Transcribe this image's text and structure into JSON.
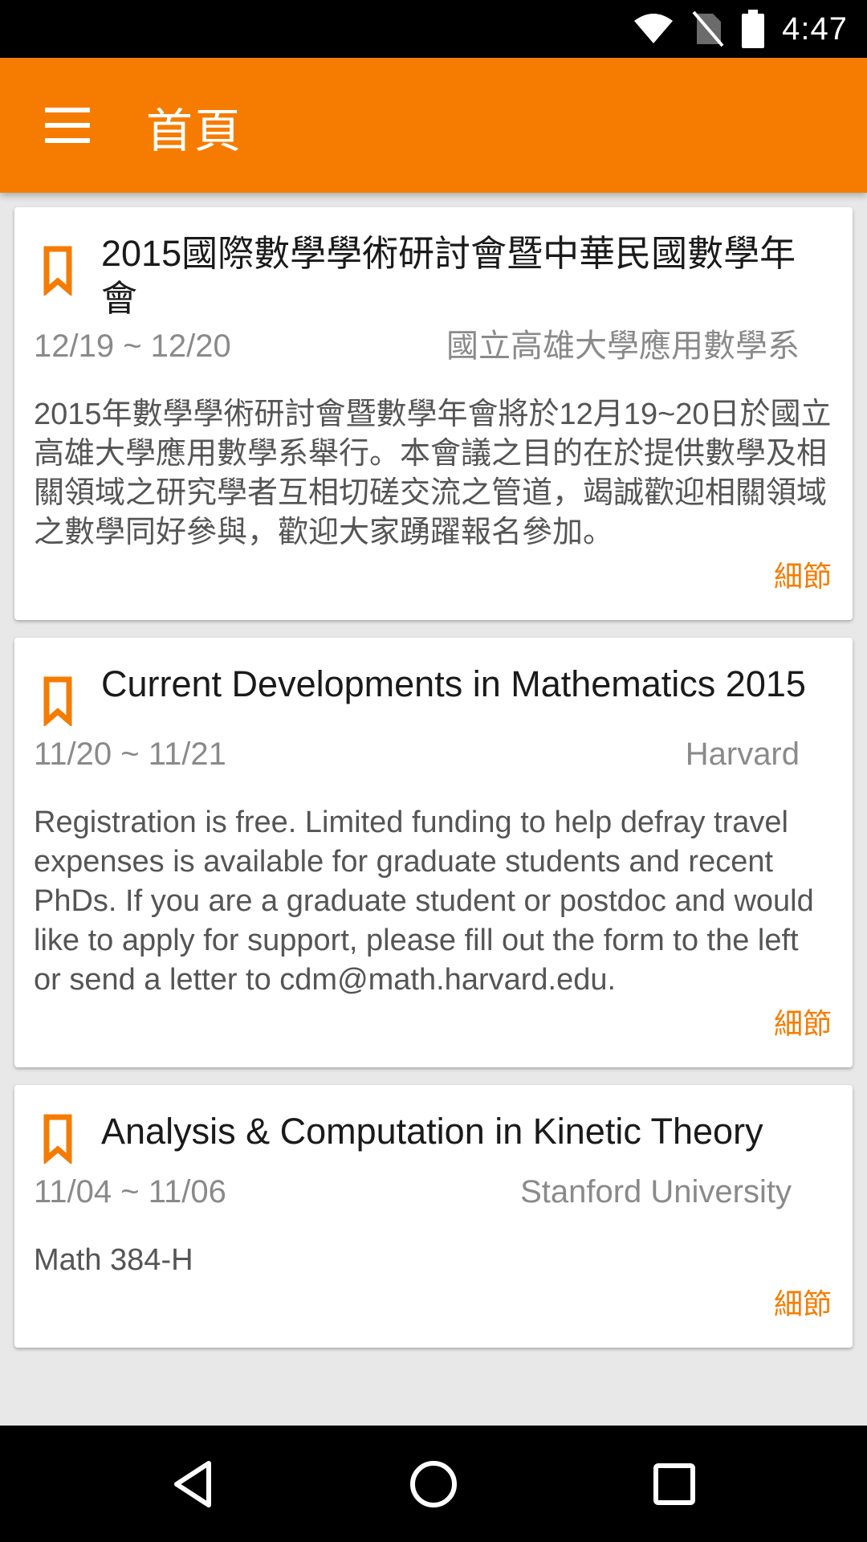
{
  "status_bar": {
    "time": "4:47",
    "icons": [
      "wifi-icon",
      "no-sim-icon",
      "battery-icon"
    ]
  },
  "app_bar": {
    "title": "首頁",
    "menu_icon": "hamburger-menu-icon",
    "color": "#f57c00"
  },
  "events": [
    {
      "title": "2015國際數學學術研討會暨中華民國數學年會",
      "dates": "12/19 ~ 12/20",
      "location": "國立高雄大學應用數學系",
      "description": "2015年數學學術研討會暨數學年會將於12月19~20日於國立高雄大學應用數學系舉行。本會議之目的在於提供數學及相關領域之研究學者互相切磋交流之管道，竭誠歡迎相關領域之數學同好參與，歡迎大家踴躍報名參加。",
      "details_label": "細節"
    },
    {
      "title": "Current Developments in Mathematics 2015",
      "dates": "11/20 ~ 11/21",
      "location": "Harvard",
      "description": "Registration is free. Limited funding to help defray travel expenses is available for graduate students and recent PhDs. If you are a graduate student or postdoc and would like to apply for support, please fill out the form to the left or send a letter to cdm@math.harvard.edu.",
      "details_label": "細節"
    },
    {
      "title": "Analysis & Computation in Kinetic Theory",
      "dates": "11/04 ~ 11/06",
      "location": "Stanford University",
      "description": "Math 384-H",
      "details_label": "細節"
    }
  ],
  "nav_bar": {
    "buttons": [
      "back-icon",
      "home-icon",
      "recents-icon"
    ]
  }
}
